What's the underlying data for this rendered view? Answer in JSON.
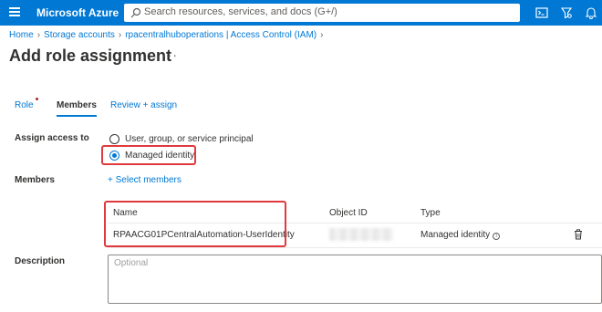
{
  "topbar": {
    "brand": "Microsoft Azure",
    "search_placeholder": "Search resources, services, and docs (G+/)",
    "icons": [
      "cloud-shell-icon",
      "directory-filter-icon",
      "notifications-icon"
    ]
  },
  "breadcrumb": {
    "items": [
      "Home",
      "Storage accounts",
      "rpacentralhuboperations | Access Control (IAM)"
    ]
  },
  "page": {
    "title": "Add role assignment",
    "more": "···"
  },
  "tabs": [
    {
      "label": "Role",
      "required": true
    },
    {
      "label": "Members",
      "active": true
    },
    {
      "label": "Review + assign"
    }
  ],
  "form": {
    "assign_access_label": "Assign access to",
    "options": [
      {
        "label": "User, group, or service principal",
        "selected": false
      },
      {
        "label": "Managed identity",
        "selected": true
      }
    ],
    "members_label": "Members",
    "select_members": "+ Select members",
    "description_label": "Description",
    "description_placeholder": "Optional"
  },
  "members_table": {
    "columns": [
      "Name",
      "Object ID",
      "Type"
    ],
    "rows": [
      {
        "name": "RPAACG01PCentralAutomation-UserIdentity",
        "object_id": "",
        "type": "Managed identity"
      }
    ]
  },
  "colors": {
    "azure_blue": "#0078d4",
    "highlight_red": "#e03a3e"
  }
}
